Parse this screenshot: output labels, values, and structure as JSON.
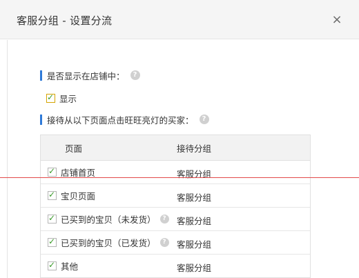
{
  "dialog": {
    "title": "客服分组 - 设置分流",
    "close_label": "×"
  },
  "section_display": {
    "label": "是否显示在店铺中：",
    "help_icon": "?",
    "checkbox_label": "显示",
    "checked": true
  },
  "section_buyers": {
    "label": "接待从以下页面点击旺旺亮灯的买家：",
    "help_icon": "?"
  },
  "table": {
    "headers": {
      "page": "页面",
      "group": "接待分组"
    },
    "rows": [
      {
        "page": "店铺首页",
        "group": "客服分组",
        "checked": true,
        "help": false
      },
      {
        "page": "宝贝页面",
        "group": "客服分组",
        "checked": true,
        "help": false
      },
      {
        "page": "已买到的宝贝（未发货）",
        "group": "客服分组",
        "checked": true,
        "help": true
      },
      {
        "page": "已买到的宝贝（已发货）",
        "group": "客服分组",
        "checked": true,
        "help": true
      },
      {
        "page": "其他",
        "group": "客服分组",
        "checked": true,
        "help": false
      }
    ]
  },
  "colors": {
    "accent": "#2f7ad8",
    "header_bg": "#f5f5f5",
    "check": "#3a9a2a",
    "overlay_line": "#e34a4a"
  }
}
